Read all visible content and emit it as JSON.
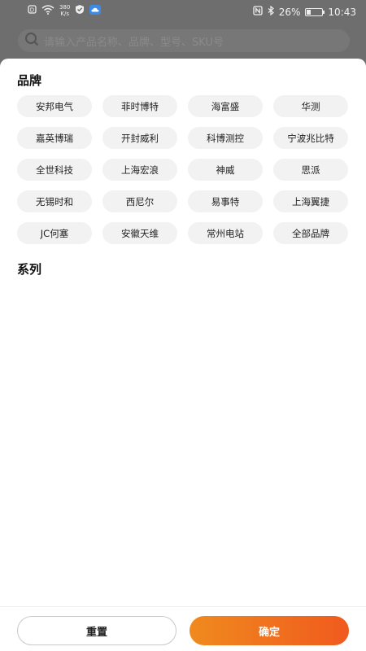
{
  "status_bar": {
    "net_speed_value": "380",
    "net_speed_unit": "K/s",
    "battery_percent": "26%",
    "battery_level": 0.26,
    "time": "10:43"
  },
  "search": {
    "placeholder": "请输入产品名称、品牌、型号、SKU号"
  },
  "filter": {
    "brand_title": "品牌",
    "series_title": "系列",
    "brands": [
      "安邦电气",
      "菲时博特",
      "海富盛",
      "华测",
      "嘉英博瑞",
      "开封威利",
      "科博测控",
      "宁波兆比特",
      "全世科技",
      "上海宏浪",
      "神威",
      "思派",
      "无锡时和",
      "西尼尔",
      "易事特",
      "上海翼捷",
      "JC何塞",
      "安徽天维",
      "常州电站",
      "全部品牌"
    ]
  },
  "footer": {
    "reset_label": "重置",
    "confirm_label": "确定"
  },
  "colors": {
    "accent": "#f07a1e",
    "chip_bg": "#f2f2f2"
  }
}
